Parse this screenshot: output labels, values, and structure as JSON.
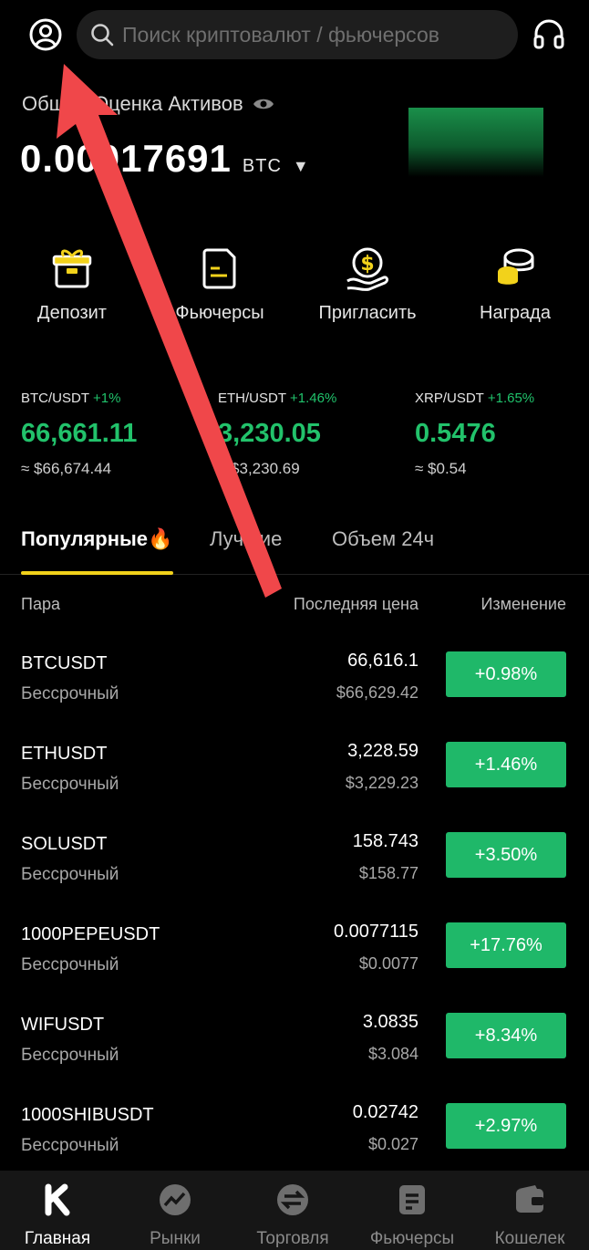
{
  "search": {
    "placeholder": "Поиск криптовалют / фьючерсов"
  },
  "assets": {
    "label": "Общая Оценка Активов",
    "value": "0.00017691",
    "unit": "BTC"
  },
  "actions": [
    {
      "label": "Депозит",
      "icon": "gift-box-icon"
    },
    {
      "label": "Фьючерсы",
      "icon": "document-icon"
    },
    {
      "label": "Пригласить",
      "icon": "coin-hand-icon"
    },
    {
      "label": "Награда",
      "icon": "coins-icon"
    }
  ],
  "tickers": [
    {
      "pair": "BTC/USDT",
      "change": "+1%",
      "price": "66,661.11",
      "usd": "≈ $66,674.44"
    },
    {
      "pair": "ETH/USDT",
      "change": "+1.46%",
      "price": "3,230.05",
      "usd": "≈ $3,230.69"
    },
    {
      "pair": "XRP/USDT",
      "change": "+1.65%",
      "price": "0.5476",
      "usd": "≈ $0.54"
    }
  ],
  "tabs": [
    {
      "label": "Популярные"
    },
    {
      "label": "Лучшие"
    },
    {
      "label": "Объем 24ч"
    }
  ],
  "table": {
    "col_pair": "Пара",
    "col_last": "Последняя цена",
    "col_change": "Изменение",
    "rows": [
      {
        "symbol": "BTCUSDT",
        "type": "Бессрочный",
        "price": "66,616.1",
        "usd": "$66,629.42",
        "change": "+0.98%"
      },
      {
        "symbol": "ETHUSDT",
        "type": "Бессрочный",
        "price": "3,228.59",
        "usd": "$3,229.23",
        "change": "+1.46%"
      },
      {
        "symbol": "SOLUSDT",
        "type": "Бессрочный",
        "price": "158.743",
        "usd": "$158.77",
        "change": "+3.50%"
      },
      {
        "symbol": "1000PEPEUSDT",
        "type": "Бессрочный",
        "price": "0.0077115",
        "usd": "$0.0077",
        "change": "+17.76%"
      },
      {
        "symbol": "WIFUSDT",
        "type": "Бессрочный",
        "price": "3.0835",
        "usd": "$3.084",
        "change": "+8.34%"
      },
      {
        "symbol": "1000SHIBUSDT",
        "type": "Бессрочный",
        "price": "0.02742",
        "usd": "$0.027",
        "change": "+2.97%"
      }
    ]
  },
  "nav": [
    {
      "label": "Главная"
    },
    {
      "label": "Рынки"
    },
    {
      "label": "Торговля"
    },
    {
      "label": "Фьючерсы"
    },
    {
      "label": "Кошелек"
    }
  ],
  "colors": {
    "up": "#1fb869",
    "accent": "#f2d21b",
    "annotation": "#f0474a"
  }
}
